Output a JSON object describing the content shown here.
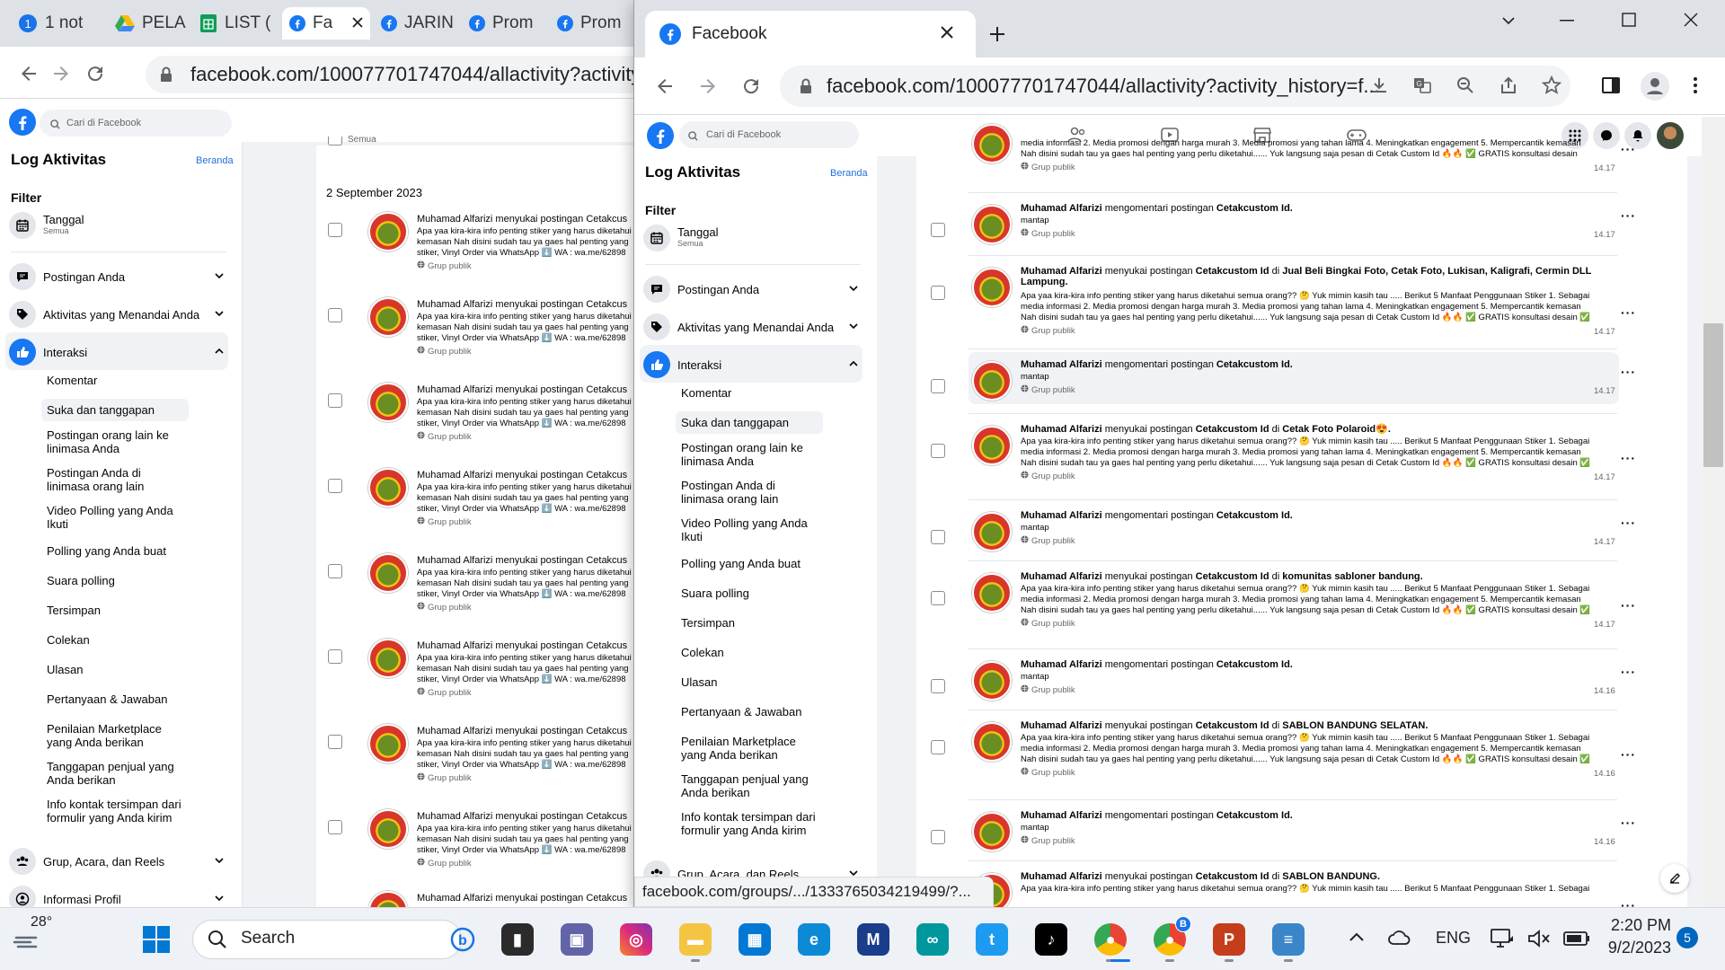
{
  "background_window": {
    "tabs": [
      {
        "label": "1 not",
        "icon": "notification-count-icon"
      },
      {
        "label": "PELA",
        "icon": "google-drive-icon"
      },
      {
        "label": "LIST (",
        "icon": "google-sheets-icon"
      },
      {
        "label": "Fa",
        "icon": "facebook-icon",
        "active": true
      },
      {
        "label": "JARIN",
        "icon": "facebook-icon"
      },
      {
        "label": "Prom",
        "icon": "facebook-icon"
      },
      {
        "label": "Prom",
        "icon": "facebook-icon"
      }
    ],
    "url": "facebook.com/100077701747044/allactivity?activity_h",
    "search_placeholder": "Cari di Facebook",
    "date_header": "2 September 2023",
    "top_check_label": "Semua",
    "row_prefix": "Muhamad Alfarizi menyukai postingan Cetakcus",
    "row_snippet": "Apa yaa kira-kira info penting stiker yang harus diketahui kemasan Nah disini sudah tau ya gaes hal penting yang stiker, Vinyl Order via WhatsApp ⬇️ WA : wa.me/62898",
    "row_meta": "Grup publik",
    "row_count": 8
  },
  "sidebar": {
    "title": "Log Aktivitas",
    "home_link": "Beranda",
    "filter_label": "Filter",
    "date_filter": {
      "label": "Tanggal",
      "sub": "Semua"
    },
    "sections": [
      {
        "label": "Postingan Anda",
        "icon": "comment-bubble-icon",
        "expanded": false
      },
      {
        "label": "Aktivitas yang Menandai Anda",
        "icon": "tag-icon",
        "expanded": false
      },
      {
        "label": "Interaksi",
        "icon": "like-icon",
        "expanded": true
      }
    ],
    "interaction_items": [
      "Komentar",
      "Suka dan tanggapan",
      "Postingan orang lain ke linimasa Anda",
      "Postingan Anda di linimasa orang lain",
      "Video Polling yang Anda Ikuti",
      "Polling yang Anda buat",
      "Suara polling",
      "Tersimpan",
      "Colekan",
      "Ulasan",
      "Pertanyaan & Jawaban",
      "Penilaian Marketplace yang Anda berikan",
      "Tanggapan penjual yang Anda berikan",
      "Info kontak tersimpan dari formulir yang Anda kirim"
    ],
    "selected_item": "Suka dan tanggapan",
    "more_sections": [
      {
        "label": "Grup, Acara, dan Reels",
        "icon": "groups-icon"
      },
      {
        "label": "Informasi Profil",
        "icon": "profile-icon"
      }
    ]
  },
  "front_window": {
    "tab_title": "Facebook",
    "url": "facebook.com/100077701747044/allactivity?activity_history=f...",
    "search_placeholder": "Cari di Facebook",
    "status_url": "facebook.com/groups/.../1333765034219499/?...",
    "activity_rows": [
      {
        "type": "partial",
        "snippet": "media informasi 2. Media promosi dengan harga murah 3. Media promosi yang tahan lama 4. Meningkatkan engagement 5. Mempercantik kemasan Nah disini sudah tau ya gaes hal penting yang perlu diketahui...... Yuk langsung saja pesan di Cetak Custom Id 🔥🔥 ✅ GRATIS konsultasi desain",
        "meta": "Grup publik",
        "time": "14.17"
      },
      {
        "type": "comment",
        "actor": "Muhamad Alfarizi",
        "verb": "mengomentari postingan",
        "target": "Cetakcustom Id.",
        "snippet": "mantap",
        "meta": "Grup publik",
        "time": "14.17"
      },
      {
        "type": "like",
        "actor": "Muhamad Alfarizi",
        "verb": "menyukai postingan",
        "target": "Cetakcustom Id",
        "place": "Jual Beli Bingkai Foto, Cetak Foto, Lukisan, Kaligrafi, Cermin DLL Lampung.",
        "snippet": "Apa yaa kira-kira info penting stiker yang harus diketahui semua orang?? 🤔 Yuk mimin kasih tau ..... Berikut 5 Manfaat Penggunaan Stiker 1. Sebagai media informasi 2. Media promosi dengan harga murah 3. Media promosi yang tahan lama 4. Meningkatkan engagement 5. Mempercantik kemasan Nah disini sudah tau ya gaes hal penting yang perlu diketahui...... Yuk langsung saja pesan di Cetak Custom Id 🔥🔥 ✅ GRATIS konsultasi desain ✅ Desai...",
        "meta": "Grup publik",
        "time": "14.17"
      },
      {
        "type": "comment",
        "actor": "Muhamad Alfarizi",
        "verb": "mengomentari postingan",
        "target": "Cetakcustom Id.",
        "snippet": "mantap",
        "meta": "Grup publik",
        "time": "14.17",
        "hover": true
      },
      {
        "type": "like",
        "actor": "Muhamad Alfarizi",
        "verb": "menyukai postingan",
        "target": "Cetakcustom Id",
        "place": "Cetak Foto Polaroid😍.",
        "snippet": "Apa yaa kira-kira info penting stiker yang harus diketahui semua orang?? 🤔 Yuk mimin kasih tau ..... Berikut 5 Manfaat Penggunaan Stiker 1. Sebagai media informasi 2. Media promosi dengan harga murah 3. Media promosi yang tahan lama 4. Meningkatkan engagement 5. Mempercantik kemasan Nah disini sudah tau ya gaes hal penting yang perlu diketahui...... Yuk langsung saja pesan di Cetak Custom Id 🔥🔥 ✅ GRATIS konsultasi desain ✅ Desai...",
        "meta": "Grup publik",
        "time": "14.17"
      },
      {
        "type": "comment",
        "actor": "Muhamad Alfarizi",
        "verb": "mengomentari postingan",
        "target": "Cetakcustom Id.",
        "snippet": "mantap",
        "meta": "Grup publik",
        "time": "14.17"
      },
      {
        "type": "like",
        "actor": "Muhamad Alfarizi",
        "verb": "menyukai postingan",
        "target": "Cetakcustom Id",
        "place": "komunitas sabloner bandung.",
        "snippet": "Apa yaa kira-kira info penting stiker yang harus diketahui semua orang?? 🤔 Yuk mimin kasih tau ..... Berikut 5 Manfaat Penggunaan Stiker 1. Sebagai media informasi 2. Media promosi dengan harga murah 3. Media promosi yang tahan lama 4. Meningkatkan engagement 5. Mempercantik kemasan Nah disini sudah tau ya gaes hal penting yang perlu diketahui...... Yuk langsung saja pesan di Cetak Custom Id 🔥🔥 ✅ GRATIS konsultasi desain ✅ Desai...",
        "meta": "Grup publik",
        "time": "14.17"
      },
      {
        "type": "comment",
        "actor": "Muhamad Alfarizi",
        "verb": "mengomentari postingan",
        "target": "Cetakcustom Id.",
        "snippet": "mantap",
        "meta": "Grup publik",
        "time": "14.16"
      },
      {
        "type": "like",
        "actor": "Muhamad Alfarizi",
        "verb": "menyukai postingan",
        "target": "Cetakcustom Id",
        "place": "SABLON BANDUNG SELATAN.",
        "snippet": "Apa yaa kira-kira info penting stiker yang harus diketahui semua orang?? 🤔 Yuk mimin kasih tau ..... Berikut 5 Manfaat Penggunaan Stiker 1. Sebagai media informasi 2. Media promosi dengan harga murah 3. Media promosi yang tahan lama 4. Meningkatkan engagement 5. Mempercantik kemasan Nah disini sudah tau ya gaes hal penting yang perlu diketahui...... Yuk langsung saja pesan di Cetak Custom Id 🔥🔥 ✅ GRATIS konsultasi desain ✅ Desai...",
        "meta": "Grup publik",
        "time": "14.16"
      },
      {
        "type": "comment",
        "actor": "Muhamad Alfarizi",
        "verb": "mengomentari postingan",
        "target": "Cetakcustom Id.",
        "snippet": "mantap",
        "meta": "Grup publik",
        "time": "14.16"
      },
      {
        "type": "like",
        "actor": "Muhamad Alfarizi",
        "verb": "menyukai postingan",
        "target": "Cetakcustom Id",
        "place": "SABLON BANDUNG.",
        "snippet": "Apa yaa kira-kira info penting stiker yang harus diketahui semua orang?? 🤔 Yuk mimin kasih tau ..... Berikut 5 Manfaat Penggunaan Stiker 1. Sebagai",
        "meta": "Grup publik",
        "time": ""
      }
    ],
    "connector_di": "di"
  },
  "taskbar": {
    "weather_temp": "28°",
    "search_label": "Search",
    "language": "ENG",
    "time": "2:20 PM",
    "date": "9/2/2023",
    "notification_count": "5",
    "apps": [
      "file-explorer-icon",
      "teams-icon",
      "instagram-icon",
      "folder-icon",
      "store-icon",
      "edge-icon",
      "malwarebytes-icon",
      "arduino-icon",
      "twitter-icon",
      "tiktok-icon",
      "chrome-icon",
      "chrome-profile-icon",
      "powerpoint-icon",
      "notepad-icon"
    ],
    "chrome_badge": "B"
  },
  "colors": {
    "facebook_blue": "#1877f2",
    "link_blue": "#216fdb",
    "taskbar_bg": "#eef1f5"
  }
}
